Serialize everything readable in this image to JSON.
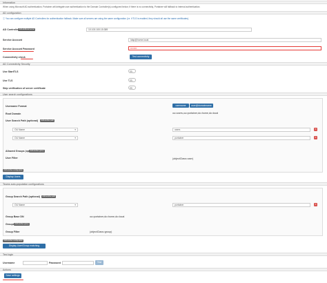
{
  "info": {
    "header": "Information",
    "text": "When using Microsoft AD authentication, Portainer will delegate user authentication to the Domain Controller(s) configured below; if there is no connectivity, Portainer will fallback to internal authentication."
  },
  "ad_config": {
    "header": "AD configuration",
    "note": "You can configure multiple AD Controllers for authentication fallback. Make sure all servers are using the same configuration (i.e. if TLS is enabled, they should all use the same certificates).",
    "controller_label": "AD Controller",
    "controller_tag": "Add additional server",
    "controller_value": "10.100.100.15:389",
    "service_account_label": "Service Account",
    "service_account_value": "ldap@home.local",
    "password_label": "Service Account Password",
    "password_value": "••••••••",
    "connectivity_label": "Connectivity check",
    "test_button": "Test connectivity"
  },
  "security": {
    "header": "AD Connectivity Security",
    "starttls": "Use StartTLS",
    "tls": "Use TLS",
    "skip_verify": "Skip verification of server certificate"
  },
  "user_search": {
    "header": "User search configurations",
    "username_format_label": "Username Format",
    "format_options": [
      "username",
      "user@domainname"
    ],
    "root_domain_label": "Root Domain",
    "root_domain_value": "ou=users,ou=portainer,dc=home,dc=local",
    "search_path_label": "User Search Path (optional)",
    "search_path_tag": "Add another path",
    "rows": [
      {
        "type": "OU Name",
        "value": "users"
      },
      {
        "type": "OU Name",
        "value": "portainer"
      }
    ],
    "allowed_groups_label": "Allowed Groups (optional)",
    "allowed_groups_tag": "Add another group",
    "user_filter_label": "User Filter",
    "user_filter_value": "(objectClass=user)",
    "advanced_tag": "Add another configuration",
    "display_button": "Display Users"
  },
  "teams": {
    "header": "Teams auto-population configurations",
    "group_search_label": "Group Search Path (optional)",
    "group_search_tag": "Add another path",
    "rows": [
      {
        "type": "OU Name",
        "value": "portainer"
      }
    ],
    "group_base_label": "Group Base DN",
    "group_base_value": "ou=portainer,dc=home,dc=local",
    "groups_label": "Groups",
    "groups_tag": "Add another group",
    "group_filter_label": "Group Filter",
    "group_filter_value": "(objectClass=group)",
    "advanced_tag": "Add another configuration",
    "display_button": "Display User/Group matching"
  },
  "test_login": {
    "header": "Test login",
    "username_label": "Username",
    "password_label": "Password",
    "test_button": "Test"
  },
  "actions": {
    "header": "Actions",
    "save_button": "Save settings"
  },
  "colors": {
    "primary": "#2f6fa7",
    "danger": "#d9534f",
    "annotation": "#e53935"
  }
}
